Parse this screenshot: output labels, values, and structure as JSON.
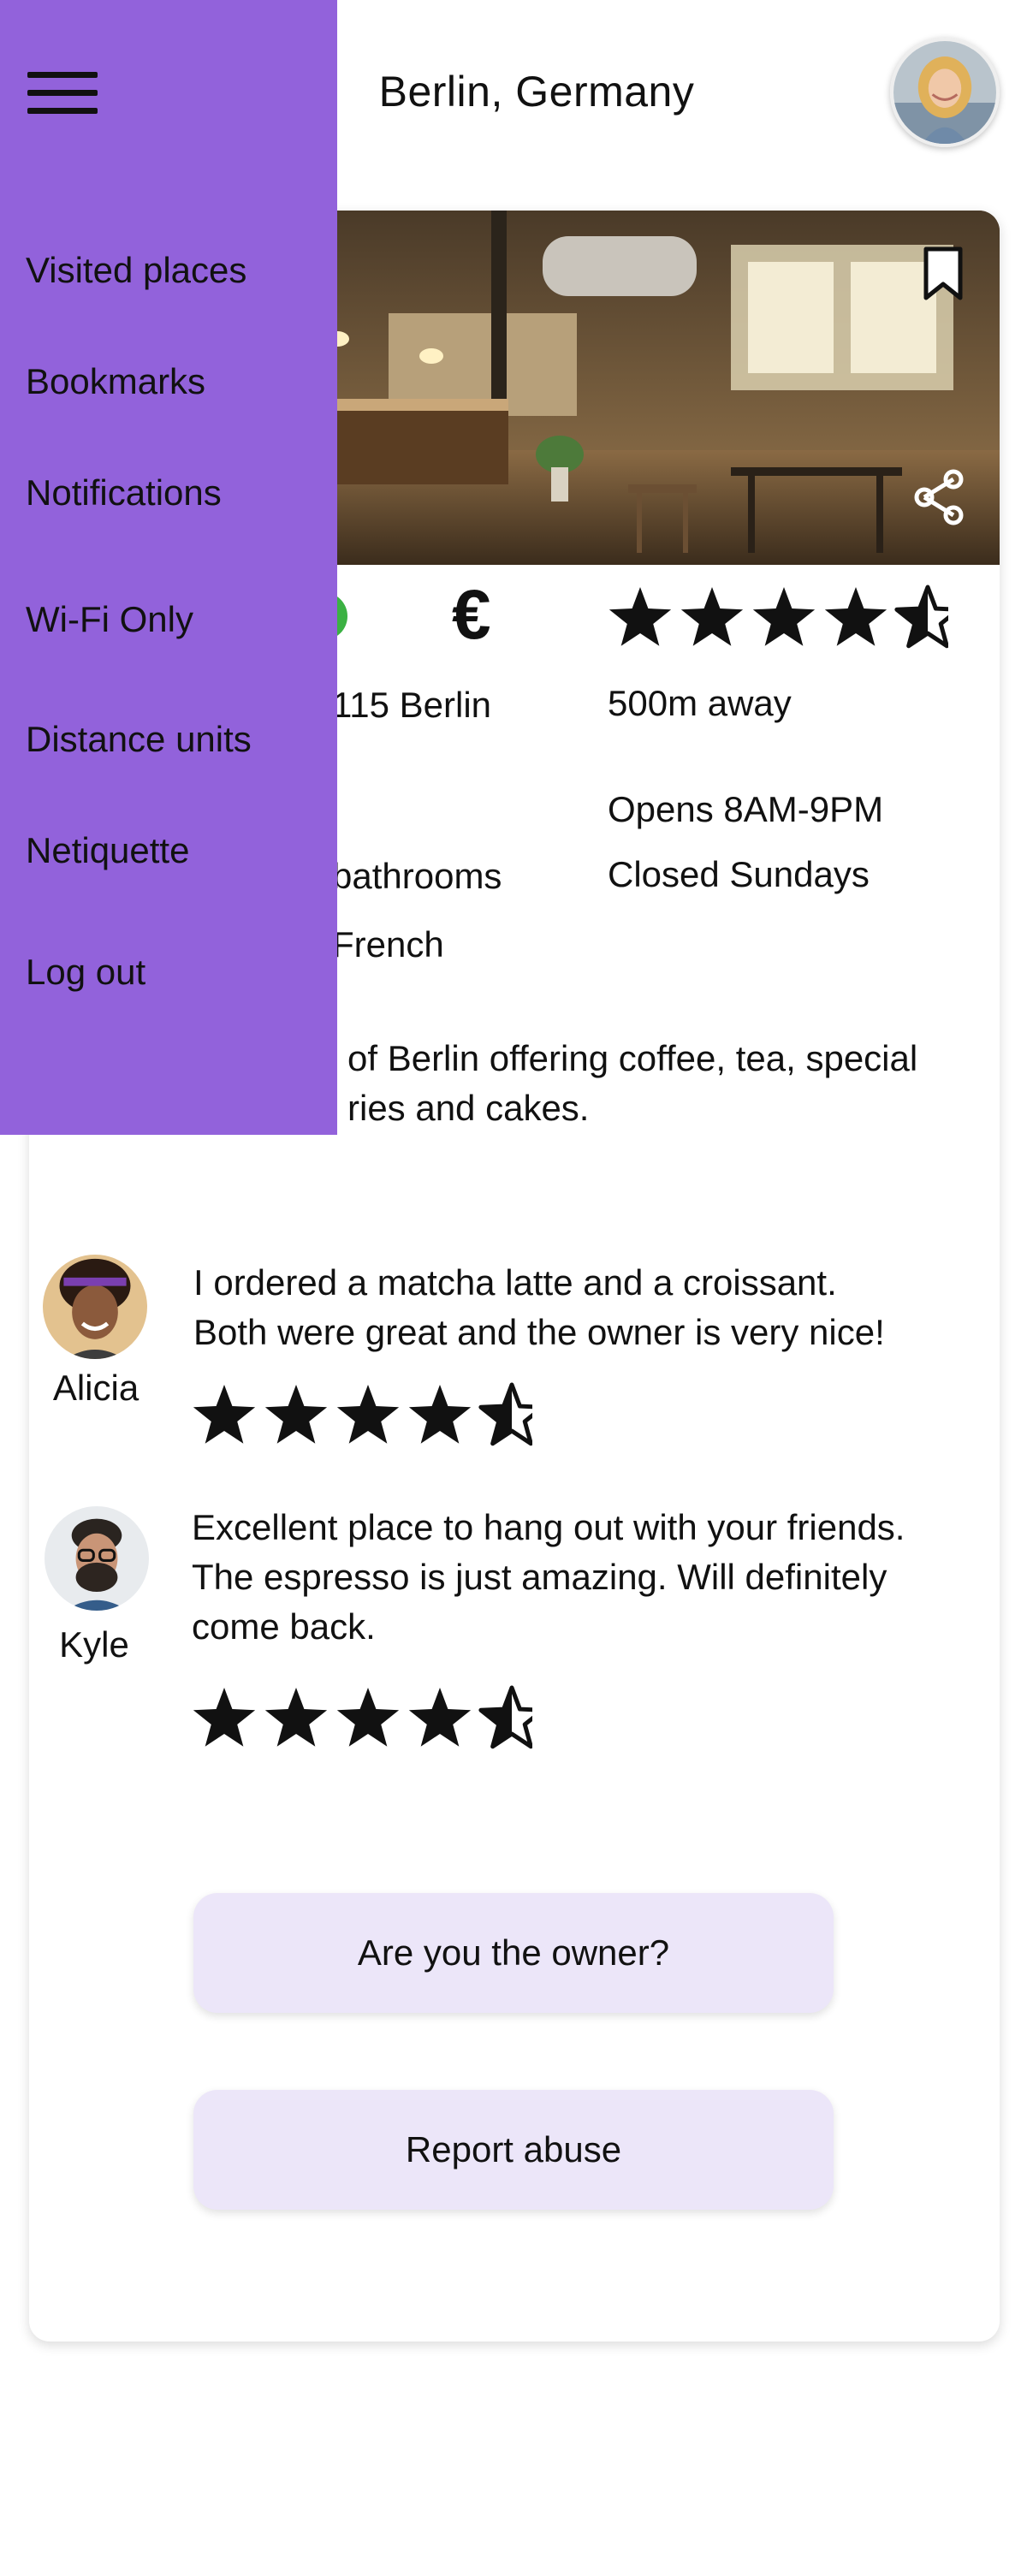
{
  "header": {
    "title": "Berlin, Germany"
  },
  "drawer": {
    "items": [
      {
        "label": "Visited places"
      },
      {
        "label": "Bookmarks"
      },
      {
        "label": "Notifications"
      },
      {
        "label": "Wi-Fi Only"
      },
      {
        "label": "Distance units"
      },
      {
        "label": "Netiquette"
      },
      {
        "label": "Log out"
      }
    ],
    "background_color": "#9262db"
  },
  "place": {
    "status_color": "#3bb143",
    "price_symbol": "€",
    "rating": 4.5,
    "address_fragment": "115 Berlin",
    "distance": "500m away",
    "hours": "Opens 8AM-9PM",
    "closed_days": "Closed Sundays",
    "amenity_fragment": "bathrooms",
    "language_fragment": "French",
    "description_line1": "of Berlin offering coffee, tea, special",
    "description_line2": "ries and cakes."
  },
  "reviews": [
    {
      "name": "Alicia",
      "text": "I ordered a matcha latte and a croissant. Both were great and the owner is very nice!",
      "line1": "I ordered a matcha latte and a croissant.",
      "line2": "Both were great and the owner is very nice!",
      "rating": 4.5
    },
    {
      "name": "Kyle",
      "text": "Excellent place to hang out with your friends. The espresso is just amazing. Will definitely come back.",
      "line1": "Excellent place to hang out with your friends.",
      "line2": "The espresso is just amazing. Will definitely",
      "line3": "come back.",
      "rating": 4.5
    }
  ],
  "actions": {
    "owner_label": "Are you the owner?",
    "report_label": "Report abuse",
    "button_color": "#ece6f9"
  },
  "icons": {
    "menu": "hamburger-icon",
    "bookmark": "bookmark-icon",
    "share": "share-icon",
    "star": "star-icon",
    "half_star": "half-star-icon"
  }
}
